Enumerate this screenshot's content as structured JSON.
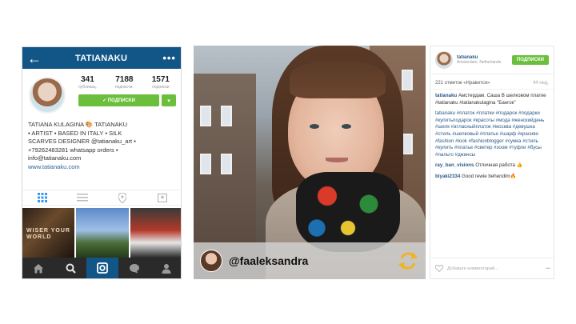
{
  "phone": {
    "header": {
      "back": "←",
      "title": "TATIANAKU",
      "more": "•••"
    },
    "stats": [
      {
        "num": "341",
        "label": "публикац."
      },
      {
        "num": "7188",
        "label": "подписчи."
      },
      {
        "num": "1571",
        "label": "подписки"
      }
    ],
    "follow_label": "✓ ПОДПИСКИ",
    "follow_dropdown": "▾",
    "bio": {
      "line1": "TATIANA KULAGINA 🎨 TATIANAKU",
      "line2": "▪ ARTIST ▪ BASED IN ITALY ▪ SILK",
      "line3": "SCARVES DESIGNER @tatianaku_art ▪",
      "line4": "+79262483281 whatsapp orders ▪",
      "line5": "info@tatianaku.com",
      "link": "www.tatianaku.com"
    },
    "grid_text": "WISER YOUR WORLD"
  },
  "photo": {
    "username": "@faaleksandra"
  },
  "comments": {
    "user": "tatianaku",
    "location": "Amsterdam, Netherlands",
    "follow": "ПОДПИСКИ",
    "likes": "221 отметок «Нравится»",
    "time": "44 нед.",
    "caption_user": "tatianaku",
    "caption_text": "Амстердам. Саша В шелковом платке #tatianaku #tatianakulagina \"Бангок\"",
    "tags": "tatianaku #платок #платки #подарок #подарки #купитьподарок #красоты #мода #женскийдень #шелк #атласныйплаток #москва #девушка #стиль #шелковый #платье #шарф #красиво #fashion #look #fashionblogger #сумка #стиль #купить #платье #светер #зоом #туфли #бусы #пальто #джинсы",
    "c1_user": "ray_ban_visions",
    "c1_text": "Отличная работа 👍",
    "c2_user": "biyaki2334",
    "c2_text": "Good rewie behendim🔥",
    "footer_placeholder": "Добавьте комментарий...",
    "footer_more": "•••"
  },
  "colors": {
    "brand_blue": "#125688",
    "follow_green": "#6bbf3c",
    "link_blue": "#2a5a88"
  }
}
